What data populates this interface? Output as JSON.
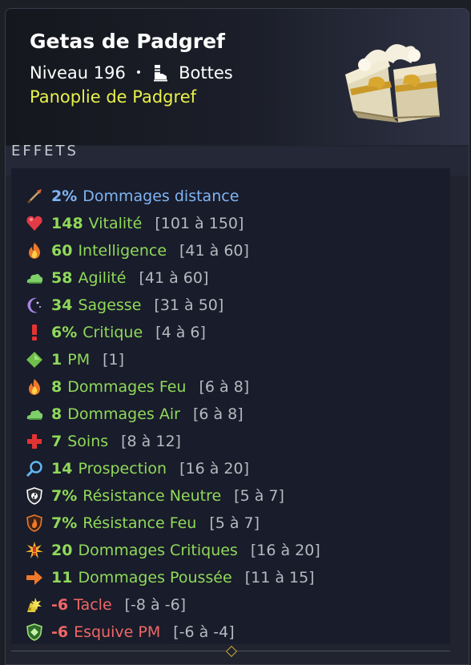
{
  "item": {
    "name": "Getas de Padgref",
    "level_label": "Niveau 196",
    "separator": "•",
    "type": "Bottes",
    "type_icon": "boot-icon",
    "set": "Panoplie de Padgref",
    "image": "boots-item-image"
  },
  "colors": {
    "positive": "#8fd95a",
    "negative": "#ef6767",
    "special": "#7fb4f5",
    "set_name": "#e8f24a",
    "range": "#b7b8c0"
  },
  "effects_section": {
    "title": "EFFETS",
    "items": [
      {
        "value": "2%",
        "label": "Dommages distance",
        "range": "",
        "kind": "special",
        "icon": "ranged-damage-icon"
      },
      {
        "value": "148",
        "label": "Vitalité",
        "range": "[101 à 150]",
        "kind": "positive",
        "icon": "heart-icon"
      },
      {
        "value": "60",
        "label": "Intelligence",
        "range": "[41 à 60]",
        "kind": "positive",
        "icon": "fire-icon"
      },
      {
        "value": "58",
        "label": "Agilité",
        "range": "[41 à 60]",
        "kind": "positive",
        "icon": "air-icon"
      },
      {
        "value": "34",
        "label": "Sagesse",
        "range": "[31 à 50]",
        "kind": "positive",
        "icon": "moon-icon"
      },
      {
        "value": "6%",
        "label": "Critique",
        "range": "[4 à 6]",
        "kind": "positive",
        "icon": "critical-icon"
      },
      {
        "value": "1",
        "label": "PM",
        "range": "[1]",
        "kind": "positive",
        "icon": "movement-points-icon"
      },
      {
        "value": "8",
        "label": "Dommages Feu",
        "range": "[6 à 8]",
        "kind": "positive",
        "icon": "fire-icon"
      },
      {
        "value": "8",
        "label": "Dommages Air",
        "range": "[6 à 8]",
        "kind": "positive",
        "icon": "air-icon"
      },
      {
        "value": "7",
        "label": "Soins",
        "range": "[8 à 12]",
        "kind": "positive",
        "icon": "heal-cross-icon"
      },
      {
        "value": "14",
        "label": "Prospection",
        "range": "[16 à 20]",
        "kind": "positive",
        "icon": "magnifier-icon"
      },
      {
        "value": "7%",
        "label": "Résistance Neutre",
        "range": "[5 à 7]",
        "kind": "positive",
        "icon": "neutral-shield-icon"
      },
      {
        "value": "7%",
        "label": "Résistance Feu",
        "range": "[5 à 7]",
        "kind": "positive",
        "icon": "fire-shield-icon"
      },
      {
        "value": "20",
        "label": "Dommages Critiques",
        "range": "[16 à 20]",
        "kind": "positive",
        "icon": "critical-damage-icon"
      },
      {
        "value": "11",
        "label": "Dommages Poussée",
        "range": "[11 à 15]",
        "kind": "positive",
        "icon": "push-arrow-icon"
      },
      {
        "value": "-6",
        "label": "Tacle",
        "range": "[-8 à -6]",
        "kind": "negative",
        "icon": "tackle-icon"
      },
      {
        "value": "-6",
        "label": "Esquive PM",
        "range": "[-6 à -4]",
        "kind": "negative",
        "icon": "dodge-shield-icon"
      }
    ]
  }
}
